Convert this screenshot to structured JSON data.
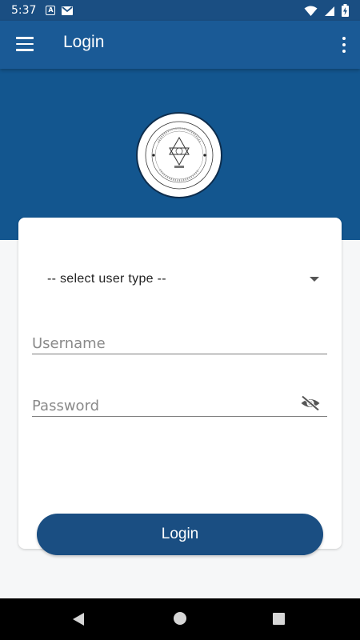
{
  "status_bar": {
    "time": "5:37",
    "notification_icons": [
      "a-box-icon",
      "gmail-icon"
    ],
    "system_icons": [
      "wifi-icon",
      "signal-icon",
      "battery-charging-icon"
    ]
  },
  "app_bar": {
    "title": "Login",
    "menu_icon": "hamburger-menu-icon",
    "more_icon": "more-vertical-icon",
    "background": "#1a5a96"
  },
  "hero": {
    "background": "#13568f",
    "logo": "institution-seal-logo"
  },
  "form": {
    "user_type": {
      "selected": "-- select user type --"
    },
    "username": {
      "placeholder": "Username",
      "value": ""
    },
    "password": {
      "placeholder": "Password",
      "value": "",
      "toggle_icon": "visibility-off-icon"
    },
    "submit_label": "Login"
  },
  "nav_bar": {
    "icons": [
      "back-icon",
      "home-icon",
      "recents-icon"
    ]
  },
  "colors": {
    "primary": "#1a4e82",
    "page_background": "#f6f7f8",
    "card": "#ffffff"
  }
}
